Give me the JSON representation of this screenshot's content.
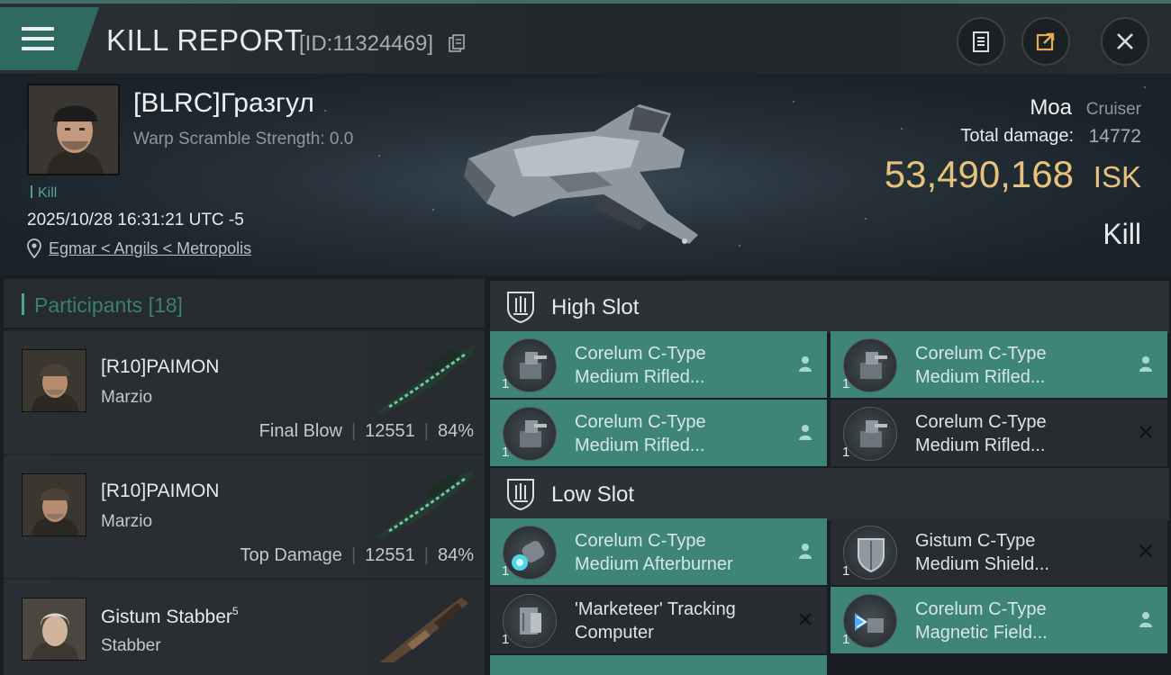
{
  "header": {
    "title": "KILL REPORT",
    "report_id": "[ID:11324469]",
    "buttons": [
      "clipboard-icon",
      "share-icon",
      "close-icon"
    ]
  },
  "victim": {
    "name": "[BLRC]Гразгул",
    "warp_scramble": "Warp Scramble Strength: 0.0",
    "tag": "Kill",
    "timestamp": "2025/10/28 16:31:21 UTC -5",
    "location": "Egmar < Angils < Metropolis"
  },
  "ship": {
    "name": "Moa",
    "class": "Cruiser",
    "total_damage_label": "Total damage:",
    "total_damage": "14772",
    "isk_value": "53,490,168",
    "isk_unit": "ISK",
    "result": "Kill"
  },
  "participants": {
    "label": "Participants",
    "count": "[18]",
    "rows": [
      {
        "name": "[R10]PAIMON",
        "ship": "Marzio",
        "role": "Final Blow",
        "damage": "12551",
        "percent": "84%"
      },
      {
        "name": "[R10]PAIMON",
        "ship": "Marzio",
        "role": "Top Damage",
        "damage": "12551",
        "percent": "84%"
      },
      {
        "name": "Gistum Stabber",
        "name_sup": "5",
        "ship": "Stabber"
      }
    ]
  },
  "slots": {
    "high": {
      "label": "High Slot",
      "items": [
        {
          "line1": "Corelum C-Type",
          "line2": "Medium Rifled...",
          "qty": "1",
          "status": "person-icon"
        },
        {
          "line1": "Corelum C-Type",
          "line2": "Medium Rifled...",
          "qty": "1",
          "status": "person-icon"
        },
        {
          "line1": "Corelum C-Type",
          "line2": "Medium Rifled...",
          "qty": "1",
          "status": "person-icon"
        },
        {
          "line1": "Corelum C-Type",
          "line2": "Medium Rifled...",
          "qty": "1",
          "status": "x-icon"
        }
      ]
    },
    "low": {
      "label": "Low Slot",
      "items": [
        {
          "line1": "Corelum C-Type",
          "line2": "Medium Afterburner",
          "qty": "1",
          "status": "person-icon"
        },
        {
          "line1": "Gistum C-Type",
          "line2": "Medium Shield...",
          "qty": "1",
          "status": "x-icon"
        },
        {
          "line1": "'Marketeer' Tracking",
          "line2": "Computer",
          "qty": "1",
          "status": "x-icon"
        },
        {
          "line1": "Corelum C-Type",
          "line2": "Magnetic Field...",
          "qty": "1",
          "status": "person-icon"
        }
      ]
    }
  },
  "colors": {
    "accent": "#3e8479",
    "isk": "#e7c27d",
    "kill_tag": "#4fa493"
  }
}
